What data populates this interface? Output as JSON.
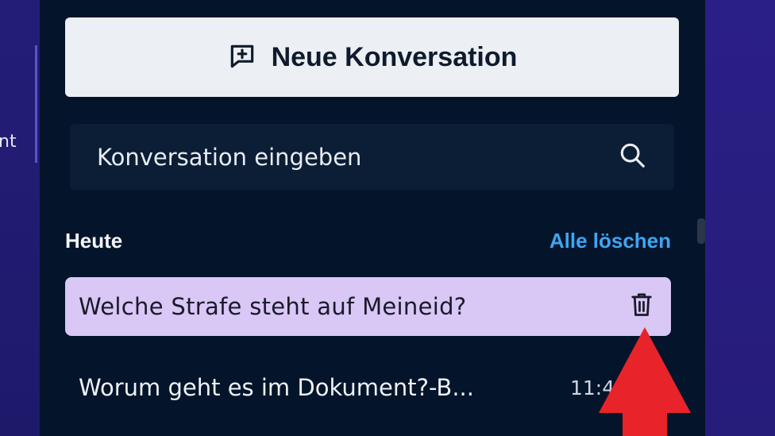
{
  "left_strip": {
    "cut_text": "nt"
  },
  "sidebar": {
    "new_conversation_label": "Neue Konversation",
    "search": {
      "placeholder": "Konversation eingeben"
    },
    "section": {
      "title": "Heute",
      "clear_all": "Alle löschen"
    },
    "conversations": [
      {
        "title": "Welche Strafe steht auf Meineid?",
        "active": true,
        "action_icon": "trash-icon"
      },
      {
        "title": "Worum geht es im Dokument?-B...",
        "time": "11:49",
        "active": false
      }
    ]
  },
  "annotation": {
    "icon": "red-up-arrow",
    "color": "#e8232a"
  },
  "colors": {
    "panel_bg": "#04142b",
    "active_item_bg": "#d9c7f6",
    "link_blue": "#3ea6f0",
    "button_bg": "#eceff3",
    "page_bg": "#1f1a6e"
  }
}
